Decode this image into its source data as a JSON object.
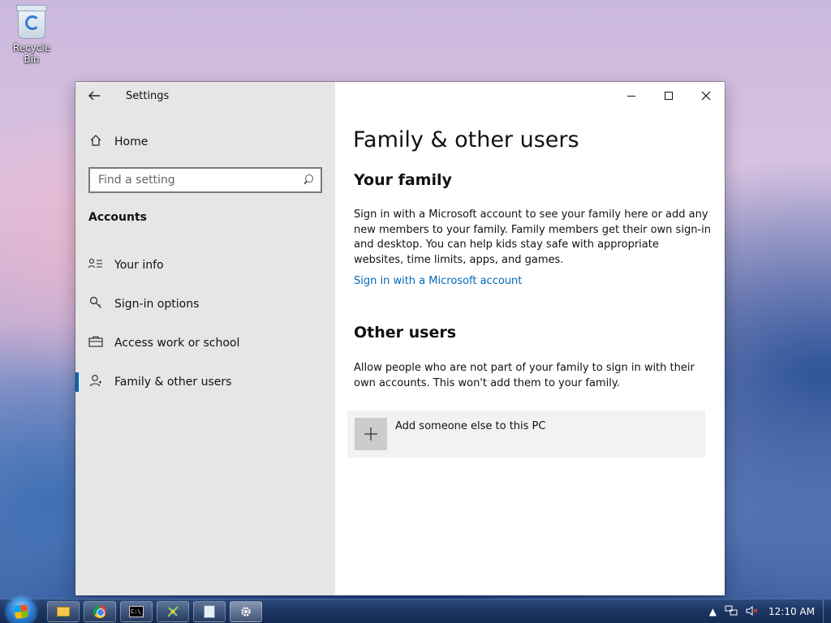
{
  "desktop": {
    "icons": [
      {
        "label": "Recycle Bin",
        "icon": "recycle-bin-icon"
      }
    ]
  },
  "window": {
    "title": "Settings",
    "controls": {
      "minimize": "minimize-icon",
      "maximize": "maximize-icon",
      "close": "close-icon"
    }
  },
  "sidebar": {
    "home_label": "Home",
    "search": {
      "placeholder": "Find a setting",
      "value": ""
    },
    "section_label": "Accounts",
    "items": [
      {
        "label": "Your info",
        "icon": "contact-card-icon",
        "active": false
      },
      {
        "label": "Sign-in options",
        "icon": "key-icon",
        "active": false
      },
      {
        "label": "Access work or school",
        "icon": "briefcase-icon",
        "active": false
      },
      {
        "label": "Family & other users",
        "icon": "person-icon",
        "active": true
      }
    ]
  },
  "main": {
    "title": "Family & other users",
    "family": {
      "heading": "Your family",
      "description": "Sign in with a Microsoft account to see your family here or add any new members to your family. Family members get their own sign-in and desktop. You can help kids stay safe with appropriate websites, time limits, apps, and games.",
      "link": "Sign in with a Microsoft account"
    },
    "other_users": {
      "heading": "Other users",
      "description": "Allow people who are not part of your family to sign in with their own accounts. This won't add them to your family.",
      "add_label": "Add someone else to this PC"
    }
  },
  "taskbar": {
    "apps": [
      {
        "icon": "file-explorer-icon"
      },
      {
        "icon": "chrome-icon"
      },
      {
        "icon": "command-prompt-icon",
        "text": "C:\\_"
      },
      {
        "icon": "app-icon"
      },
      {
        "icon": "notepad-icon"
      },
      {
        "icon": "settings-gear-icon",
        "active": true
      }
    ],
    "tray": {
      "clock": "12:10 AM"
    }
  },
  "colors": {
    "accent": "#0063b1",
    "link": "#0067b8",
    "sidebar_bg": "#e6e6e6"
  }
}
